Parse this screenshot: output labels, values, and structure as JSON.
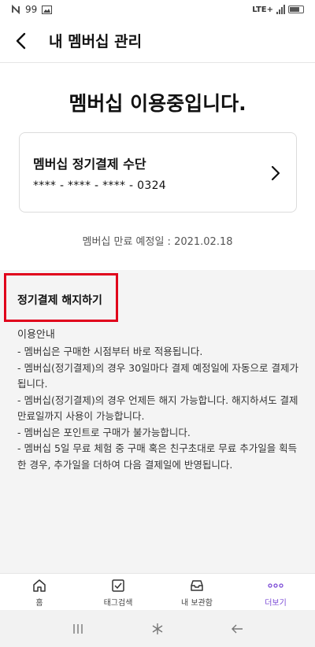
{
  "status_bar": {
    "left_text": "99",
    "network": "LTE+"
  },
  "header": {
    "title": "내 멤버십 관리"
  },
  "main": {
    "heading": "멤버십 이용중입니다.",
    "payment_card": {
      "title": "멤버십 정기결제 수단",
      "number": "**** - **** - **** - 0324"
    },
    "expiry": "멤버십 만료 예정일 : 2021.02.18"
  },
  "info": {
    "cancel_label": "정기결제 해지하기",
    "title": "이용안내",
    "items": [
      "- 멤버십은 구매한 시점부터 바로 적용됩니다.",
      "- 멤버십(정기결제)의 경우 30일마다 결제 예정일에 자동으로 결제가 됩니다.",
      "- 멤버십(정기결제)의 경우 언제든 해지 가능합니다. 해지하셔도 결제 만료일까지 사용이 가능합니다.",
      "- 멤버십은 포인트로 구매가 불가능합니다.",
      "- 멤버십 5일 무료 체험 중 구매 혹은 친구초대로 무료 추가일을 획득한 경우, 추가일을 더하여 다음 결제일에 반영됩니다."
    ]
  },
  "bottom_nav": [
    {
      "label": "홈",
      "icon": "home-icon"
    },
    {
      "label": "태그검색",
      "icon": "checkbox-icon"
    },
    {
      "label": "내 보관함",
      "icon": "inbox-icon"
    },
    {
      "label": "더보기",
      "icon": "more-icon",
      "active": true
    }
  ],
  "colors": {
    "accent": "#7b4bd6",
    "highlight": "#e0001b",
    "section_bg": "#f4f4f4"
  }
}
